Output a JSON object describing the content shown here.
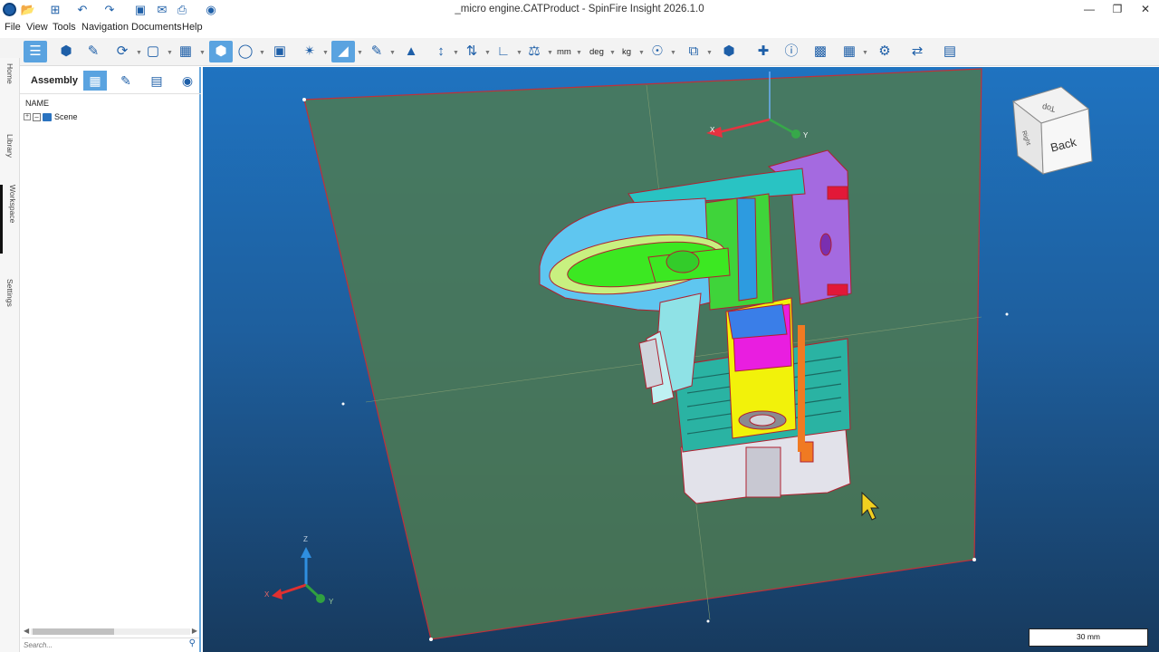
{
  "window": {
    "title": "_micro engine.CATProduct - SpinFire Insight 2026.1.0",
    "controls": [
      "minimize-icon",
      "restore-icon",
      "close-icon"
    ]
  },
  "menu": {
    "items": [
      "File",
      "View",
      "Tools",
      "Navigation",
      "Documents",
      "Help"
    ]
  },
  "toolbar": {
    "units": {
      "length": "mm",
      "angle": "deg",
      "mass": "kg"
    }
  },
  "side_tabs": [
    "Home",
    "Library",
    "Workspace",
    "Settings"
  ],
  "panel": {
    "title": "Assembly",
    "column_header": "NAME",
    "tree": [
      {
        "label": "Scene"
      }
    ],
    "search_placeholder": "Search..."
  },
  "viewport": {
    "view_cube_face": "Back",
    "view_cube_top": "Top",
    "view_cube_side": "Right",
    "triad_axes": {
      "x": "X",
      "y": "Y",
      "z": "Z"
    },
    "scale_label": "30 mm",
    "colors": {
      "accent": "#5aa3e0",
      "section_plane": "#4e7a52",
      "background_top": "#1f73c0",
      "background_bottom": "#173a5e"
    }
  }
}
